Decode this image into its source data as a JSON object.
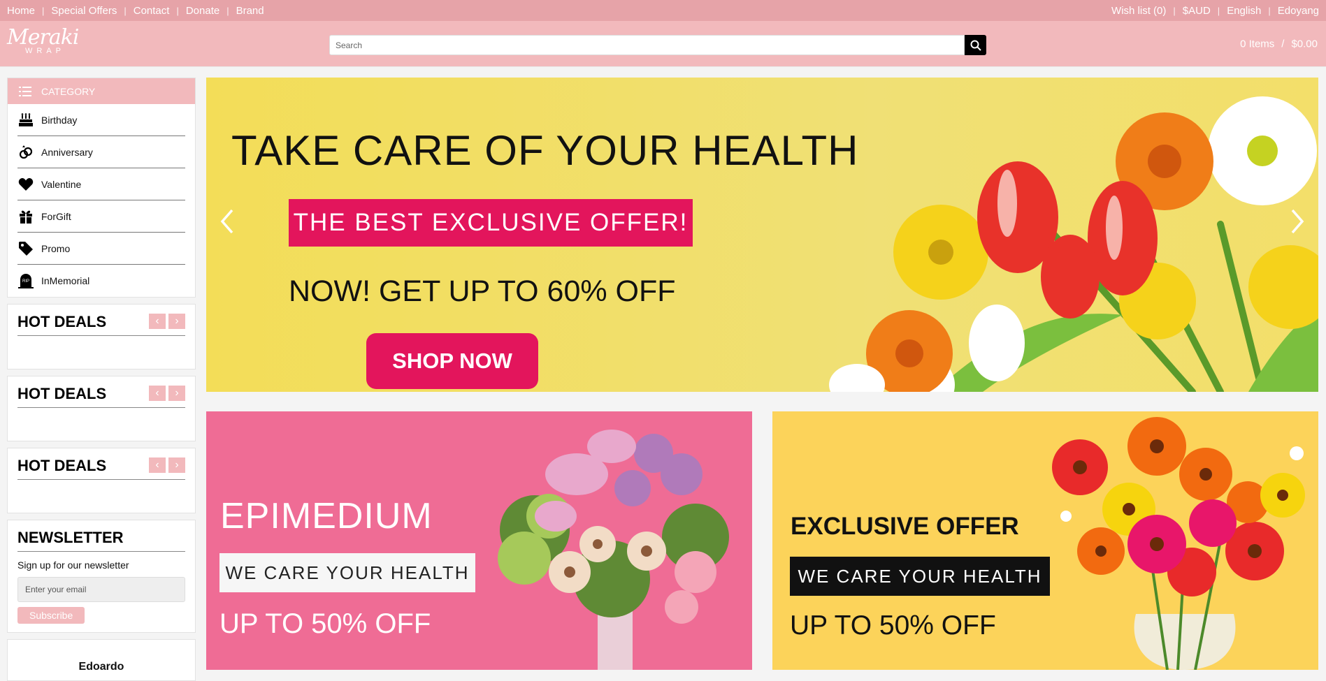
{
  "topbar": {
    "links": [
      "Home",
      "Special Offers",
      "Contact",
      "Donate",
      "Brand"
    ],
    "right": [
      "Wish list (0)",
      "$AUD",
      "English",
      "Edoyang"
    ]
  },
  "header": {
    "logo_script": "Meraki",
    "logo_sub": "WRAP",
    "search_placeholder": "Search",
    "cart_items": "0 Items",
    "cart_total": "$0.00"
  },
  "sidebar": {
    "category_title": "CATEGORY",
    "categories": [
      {
        "label": "Birthday",
        "icon": "cake-icon"
      },
      {
        "label": "Anniversary",
        "icon": "rings-icon"
      },
      {
        "label": "Valentine",
        "icon": "heart-icon"
      },
      {
        "label": "ForGift",
        "icon": "gift-icon"
      },
      {
        "label": "Promo",
        "icon": "tag-icon"
      },
      {
        "label": "InMemorial",
        "icon": "tombstone-icon"
      }
    ],
    "deals_title": "HOT DEALS",
    "newsletter": {
      "title": "NEWSLETTER",
      "text": "Sign up for our newsletter",
      "placeholder": "Enter your email",
      "button": "Subscribe"
    },
    "bottom_card": "Edoardo"
  },
  "hero": {
    "headline": "TAKE CARE OF YOUR HEALTH",
    "offer": "THE BEST EXCLUSIVE OFFER!",
    "subline": "NOW! GET UP TO 60% OFF",
    "button": "SHOP NOW"
  },
  "banners": {
    "left": {
      "title": "EPIMEDIUM",
      "tag": "WE CARE YOUR  HEALTH",
      "discount": "UP TO 50% OFF"
    },
    "right": {
      "title": "EXCLUSIVE OFFER",
      "tag": "WE CARE YOUR  HEALTH",
      "discount": "UP TO 50% OFF"
    }
  },
  "colors": {
    "accent_pink": "#f2b9bc",
    "topbar": "#e6a3a8",
    "hot_pink": "#e3155c"
  }
}
